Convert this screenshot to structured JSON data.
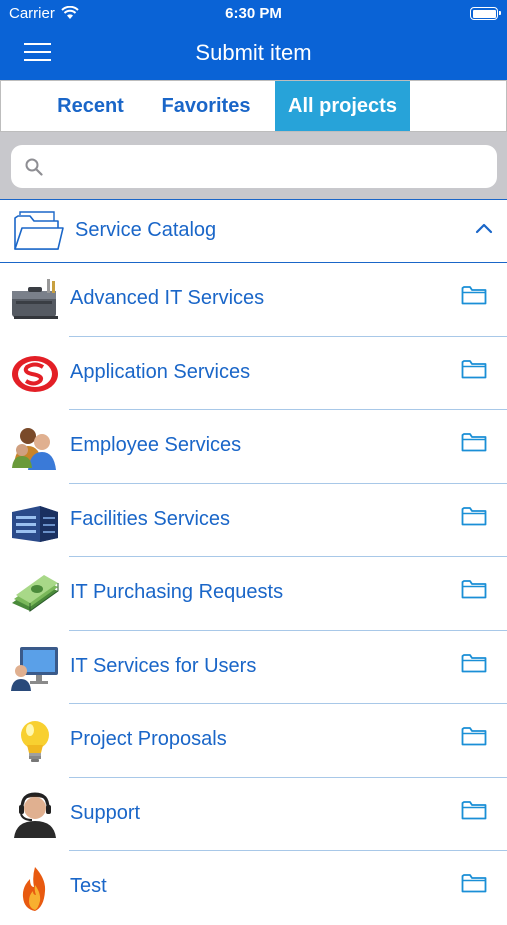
{
  "status_bar": {
    "carrier": "Carrier",
    "time": "6:30 PM"
  },
  "header": {
    "title": "Submit item"
  },
  "tabs": [
    {
      "label": "Recent",
      "active": false
    },
    {
      "label": "Favorites",
      "active": false
    },
    {
      "label": "All projects",
      "active": true
    }
  ],
  "search": {
    "placeholder": "",
    "value": ""
  },
  "catalog": {
    "title": "Service Catalog",
    "expanded": true
  },
  "items": [
    {
      "label": "Advanced IT Services",
      "icon": "toolbox-icon"
    },
    {
      "label": "Application Services",
      "icon": "application-logo-icon"
    },
    {
      "label": "Employee Services",
      "icon": "people-icon"
    },
    {
      "label": "Facilities Services",
      "icon": "building-icon"
    },
    {
      "label": "IT Purchasing Requests",
      "icon": "money-icon"
    },
    {
      "label": "IT Services for Users",
      "icon": "computer-user-icon"
    },
    {
      "label": "Project Proposals",
      "icon": "lightbulb-icon"
    },
    {
      "label": "Support",
      "icon": "headset-agent-icon"
    },
    {
      "label": "Test",
      "icon": "fire-icon"
    }
  ],
  "colors": {
    "header": "#0a63d6",
    "accent": "#1a66c8",
    "active_tab": "#27a3d9",
    "search_bg": "#c8c8cc"
  }
}
